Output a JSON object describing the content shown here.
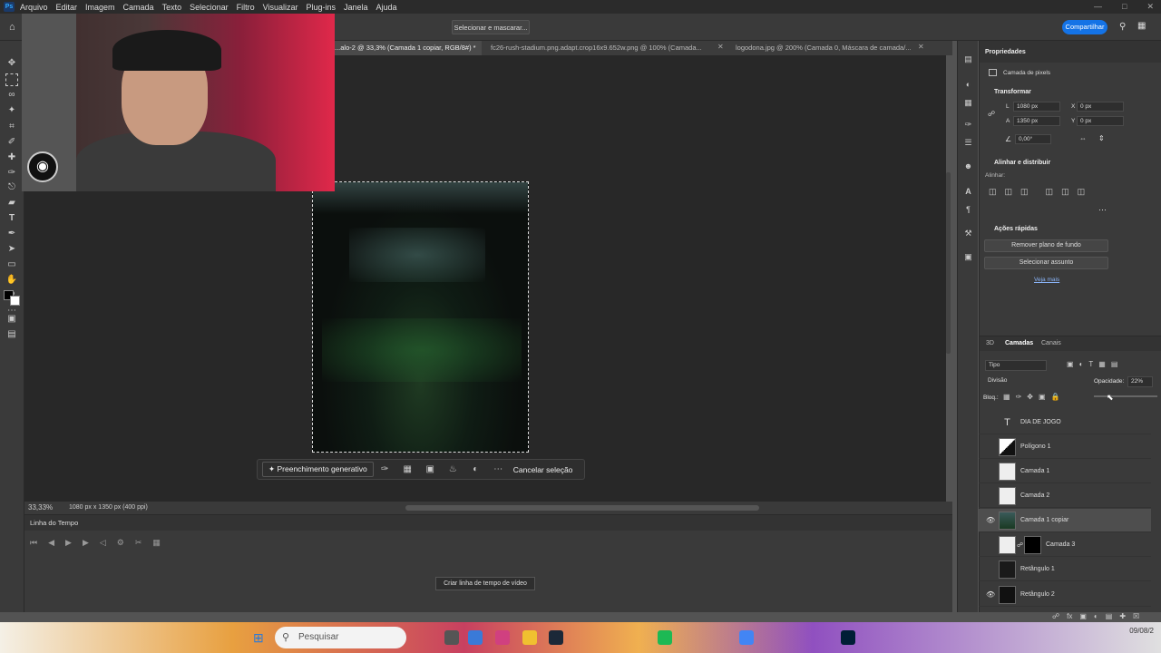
{
  "menu": {
    "app_icon": "Ps",
    "items": [
      "Arquivo",
      "Editar",
      "Imagem",
      "Camada",
      "Texto",
      "Selecionar",
      "Filtro",
      "Visualizar",
      "Plug-ins",
      "Janela",
      "Ajuda"
    ]
  },
  "options": {
    "select_mask": "Selecionar e mascarar...",
    "share": "Compartilhar"
  },
  "tabs": [
    {
      "label": "...alo-2 @ 33,3% (Camada 1 copiar, RGB/8#) *",
      "active": true
    },
    {
      "label": "fc26-rush-stadium.png.adapt.crop16x9.652w.png @ 100% (Camada...",
      "active": false
    },
    {
      "label": "logodona.jpg @ 200% (Camada 0, Máscara de camada/...",
      "active": false
    }
  ],
  "context_bar": {
    "generative_fill": "Preenchimento generativo",
    "cancel": "Cancelar seleção"
  },
  "status": {
    "zoom": "33,33%",
    "doc_info": "1080 px x 1350 px (400 ppi)"
  },
  "timeline": {
    "title": "Linha do Tempo",
    "create_button": "Criar linha de tempo de vídeo"
  },
  "properties": {
    "title": "Propriedades",
    "layer_kind": "Camada de pixels",
    "transform": {
      "title": "Transformar",
      "w_label": "L",
      "w": "1080 px",
      "h_label": "A",
      "h": "1350 px",
      "x_label": "X",
      "x": "0 px",
      "y_label": "Y",
      "y": "0 px",
      "angle": "0,00°"
    },
    "align": {
      "title": "Alinhar e distribuir",
      "subtitle": "Alinhar:"
    },
    "quick_actions": {
      "title": "Ações rápidas",
      "remove_bg": "Remover plano de fundo",
      "select_subject": "Selecionar assunto",
      "see_more": "Veja mais"
    }
  },
  "layers_panel": {
    "tabs": [
      "3D",
      "Camadas",
      "Canais"
    ],
    "active_tab": "Camadas",
    "filter": "Tipo",
    "blend_mode": "Divisão",
    "opacity_label": "Opacidade:",
    "opacity": "22%",
    "lock_label": "Bloq.:",
    "layers": [
      {
        "name": "DIA DE JOGO",
        "visible": false,
        "type": "text"
      },
      {
        "name": "Polígono 1",
        "visible": false,
        "type": "shape"
      },
      {
        "name": "Camada 1",
        "visible": false,
        "type": "pixel"
      },
      {
        "name": "Camada 2",
        "visible": false,
        "type": "pixel"
      },
      {
        "name": "Camada 1 copiar",
        "visible": true,
        "type": "pixel",
        "selected": true
      },
      {
        "name": "Camada 3",
        "visible": false,
        "type": "masked"
      },
      {
        "name": "Retângulo 1",
        "visible": false,
        "type": "shape"
      },
      {
        "name": "Retângulo 2",
        "visible": true,
        "type": "shape"
      }
    ]
  },
  "taskbar": {
    "search_placeholder": "Pesquisar",
    "date": "09/08/2"
  },
  "colors": {
    "accent": "#1473e6",
    "canvas_bg": "#282828",
    "panel_bg": "#3a3a3a"
  }
}
